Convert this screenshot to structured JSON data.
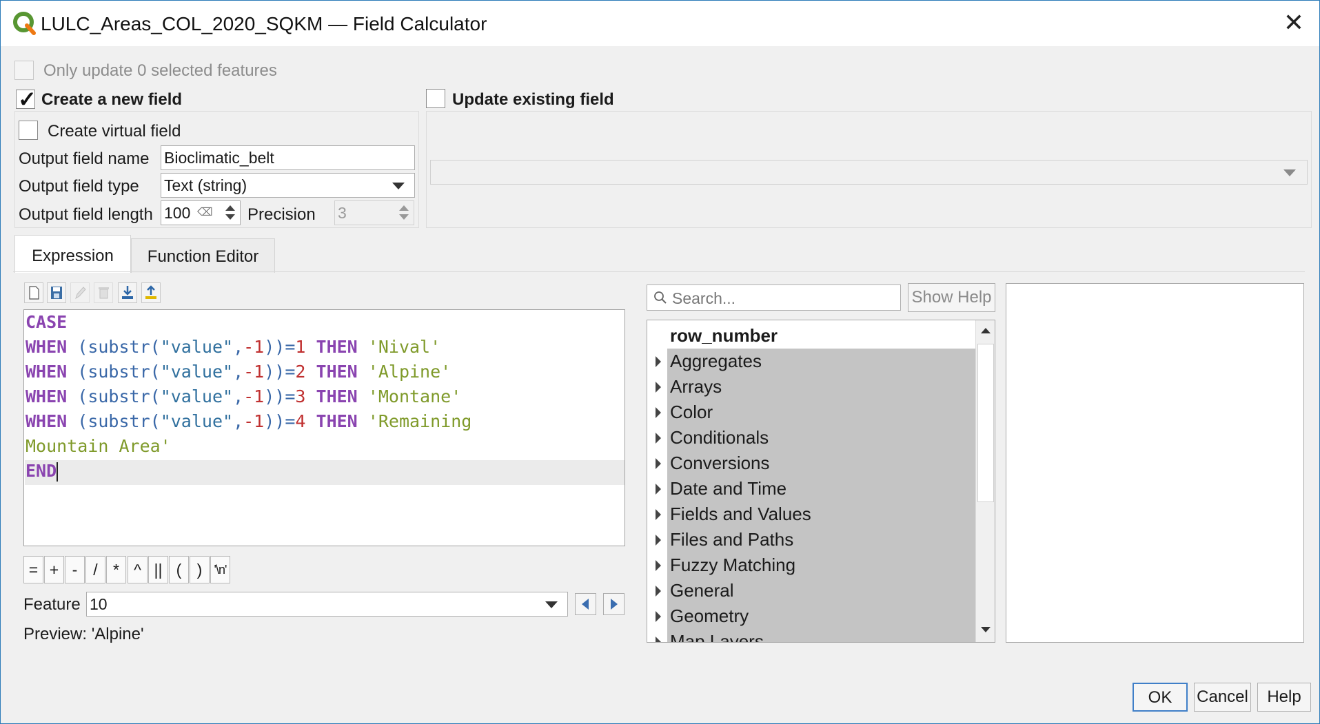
{
  "window": {
    "title": "LULC_Areas_COL_2020_SQKM — Field Calculator"
  },
  "options": {
    "only_update_label": "Only update 0 selected features",
    "create_new_field_label": "Create a new field",
    "update_existing_label": "Update existing field",
    "create_virtual_label": "Create virtual field",
    "output_name_label": "Output field name",
    "output_name_value": "Bioclimatic_belt",
    "output_type_label": "Output field type",
    "output_type_value": "Text (string)",
    "output_length_label": "Output field length",
    "output_length_value": "100",
    "precision_label": "Precision",
    "precision_value": "3"
  },
  "tabs": {
    "expression": "Expression",
    "function_editor": "Function Editor"
  },
  "toolbar_icons": [
    "new-file-icon",
    "save-icon",
    "edit-icon",
    "delete-icon",
    "import-icon",
    "export-icon"
  ],
  "expression": {
    "line1_kw": "CASE",
    "when": "WHEN",
    "then": "THEN",
    "end": "END",
    "func_open": "(substr(",
    "field": "\"value\"",
    "comma": ",",
    "neg_one": "-1",
    "close_eq": "))=",
    "v1": "1",
    "v2": "2",
    "v3": "3",
    "v4": "4",
    "s1": "'Nival'",
    "s2": "'Alpine'",
    "s3": "'Montane'",
    "s4a": "'Remaining",
    "s4b": "Mountain Area'"
  },
  "operators": [
    "=",
    "+",
    "-",
    "/",
    "*",
    "^",
    "||",
    "(",
    ")",
    "'\\n'"
  ],
  "feature": {
    "label": "Feature",
    "value": "10"
  },
  "preview": "Preview: 'Alpine'",
  "search": {
    "placeholder": "Search...",
    "show_help": "Show Help"
  },
  "function_tree": {
    "items": [
      "row_number",
      "Aggregates",
      "Arrays",
      "Color",
      "Conditionals",
      "Conversions",
      "Date and Time",
      "Fields and Values",
      "Files and Paths",
      "Fuzzy Matching",
      "General",
      "Geometry",
      "Map Layers"
    ]
  },
  "buttons": {
    "ok": "OK",
    "cancel": "Cancel",
    "help": "Help"
  },
  "colors": {
    "keyword": "#8a44b0",
    "function": "#3a68a8",
    "number": "#c03030",
    "string": "#7f9a2a",
    "selection_gray": "#c4c4c4",
    "window_border": "#2a7ab8"
  }
}
